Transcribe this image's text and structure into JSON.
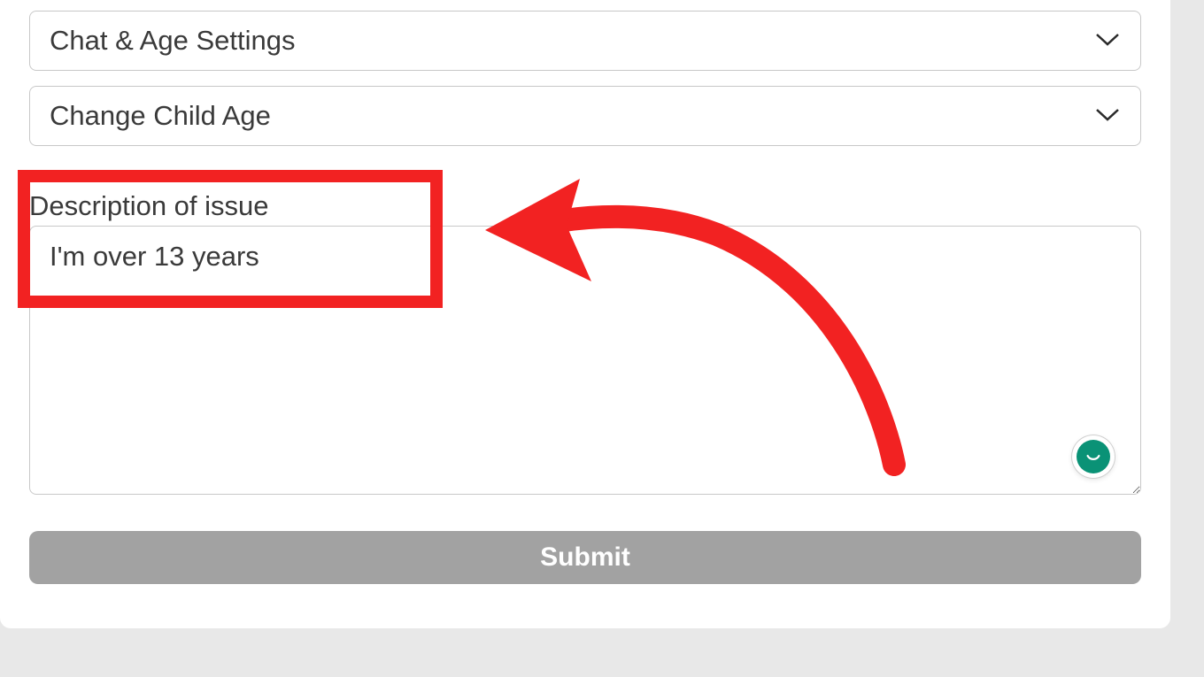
{
  "dropdowns": [
    {
      "label": "Chat & Age Settings"
    },
    {
      "label": "Change Child Age"
    }
  ],
  "description": {
    "label": "Description of issue",
    "value": "I'm over 13 years"
  },
  "buttons": {
    "submit_label": "Submit"
  },
  "annotations": {
    "highlight_color": "#f22222"
  }
}
